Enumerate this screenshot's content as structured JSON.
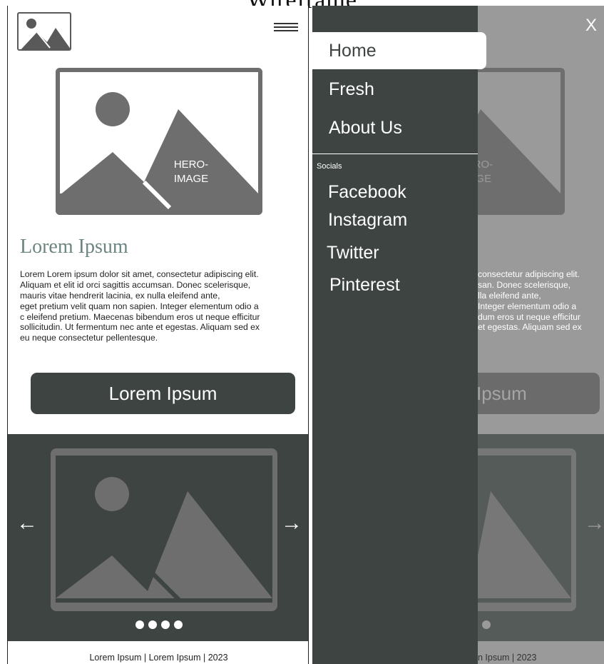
{
  "page": {
    "title": "Wireframe"
  },
  "left_screen": {
    "logo_icon": "image-placeholder-icon",
    "menu_icon": "hamburger-icon",
    "hero": {
      "label_line1": "HERO-",
      "label_line2": "IMAGE"
    },
    "section_title": "Lorem Ipsum",
    "body_lines": [
      "Lorem Lorem ipsum dolor sit amet, consectetur adipiscing elit.",
      "Aliquam et elit id orci sagittis accumsan. Donec scelerisque,",
      "mauris vitae hendrerit lacinia, ex nulla eleifend ante,",
      "eget pretium velit quam non sapien. Integer elementum odio a",
      "c eleifend pretium. Maecenas bibendum eros ut neque efficitur",
      "sollicitudin.  Ut fermentum nec ante et egestas. Aliquam sed ex",
      "eu neque consectetur pellentesque."
    ],
    "cta_label": "Lorem Ipsum",
    "carousel": {
      "prev_icon": "arrow-left-icon",
      "next_icon": "arrow-right-icon",
      "dot_count": 4
    },
    "footer": "Lorem Ipsum | Lorem Ipsum | 2023"
  },
  "right_screen": {
    "close_label": "X",
    "menu_items": [
      {
        "label": "Home",
        "active": true
      },
      {
        "label": "Fresh",
        "active": false
      },
      {
        "label": "About Us",
        "active": false
      }
    ],
    "socials_label": "Socials",
    "social_items": [
      "Facebook",
      "Instagram",
      "Twitter",
      "Pinterest"
    ],
    "dimmed_hero": {
      "label_line1": "HERO-",
      "label_line2": "MAGE"
    },
    "dimmed_body_lines": [
      "consectetur adipiscing elit.",
      "san. Donec scelerisque,",
      "lla eleifend ante,",
      "Integer elementum odio a",
      "dum eros ut neque efficitur",
      "et egestas. Aliquam sed ex"
    ],
    "dimmed_cta_label": "Ipsum",
    "dimmed_footer": "n Ipsum | 2023"
  },
  "colors": {
    "dark": "#3d4442",
    "accent_title": "#6c8581",
    "placeholder": "#6e6e6e",
    "overlay": "#9a9a9a"
  }
}
